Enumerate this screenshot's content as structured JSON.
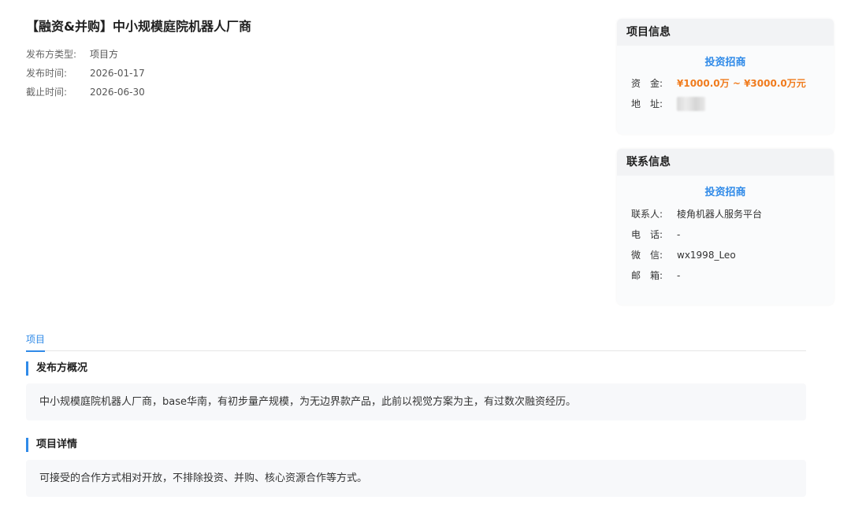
{
  "title": "【融资&并购】中小规模庭院机器人厂商",
  "meta": [
    {
      "label": "发布方类型:",
      "value": "项目方"
    },
    {
      "label": "发布时间:",
      "value": "2026-01-17"
    },
    {
      "label": "截止时间:",
      "value": "2026-06-30"
    }
  ],
  "project_info": {
    "header": "项目信息",
    "link": "投资招商",
    "funding_label": "资　金:",
    "funding_value": "¥1000.0万 ~ ¥3000.0万元",
    "address_label": "地　址:",
    "address_value": ""
  },
  "contact_info": {
    "header": "联系信息",
    "link": "投资招商",
    "contact_label": "联系人:",
    "contact_value": "棱角机器人服务平台",
    "phone_label": "电　话:",
    "phone_value": "-",
    "wechat_label": "微　信:",
    "wechat_value": "wx1998_Leo",
    "email_label": "邮　箱:",
    "email_value": "-"
  },
  "tabs": {
    "active": "项目"
  },
  "sections": {
    "publisher_title": "发布方概况",
    "publisher_text": "中小规模庭院机器人厂商，base华南，有初步量产规模，为无边界款产品，此前以视觉方案为主，有过数次融资经历。",
    "details_title": "项目详情",
    "details_text": "可接受的合作方式相对开放，不排除投资、并购、核心资源合作等方式。"
  },
  "colors": {
    "accent": "#2f8ae8",
    "money": "#f07b1d"
  }
}
